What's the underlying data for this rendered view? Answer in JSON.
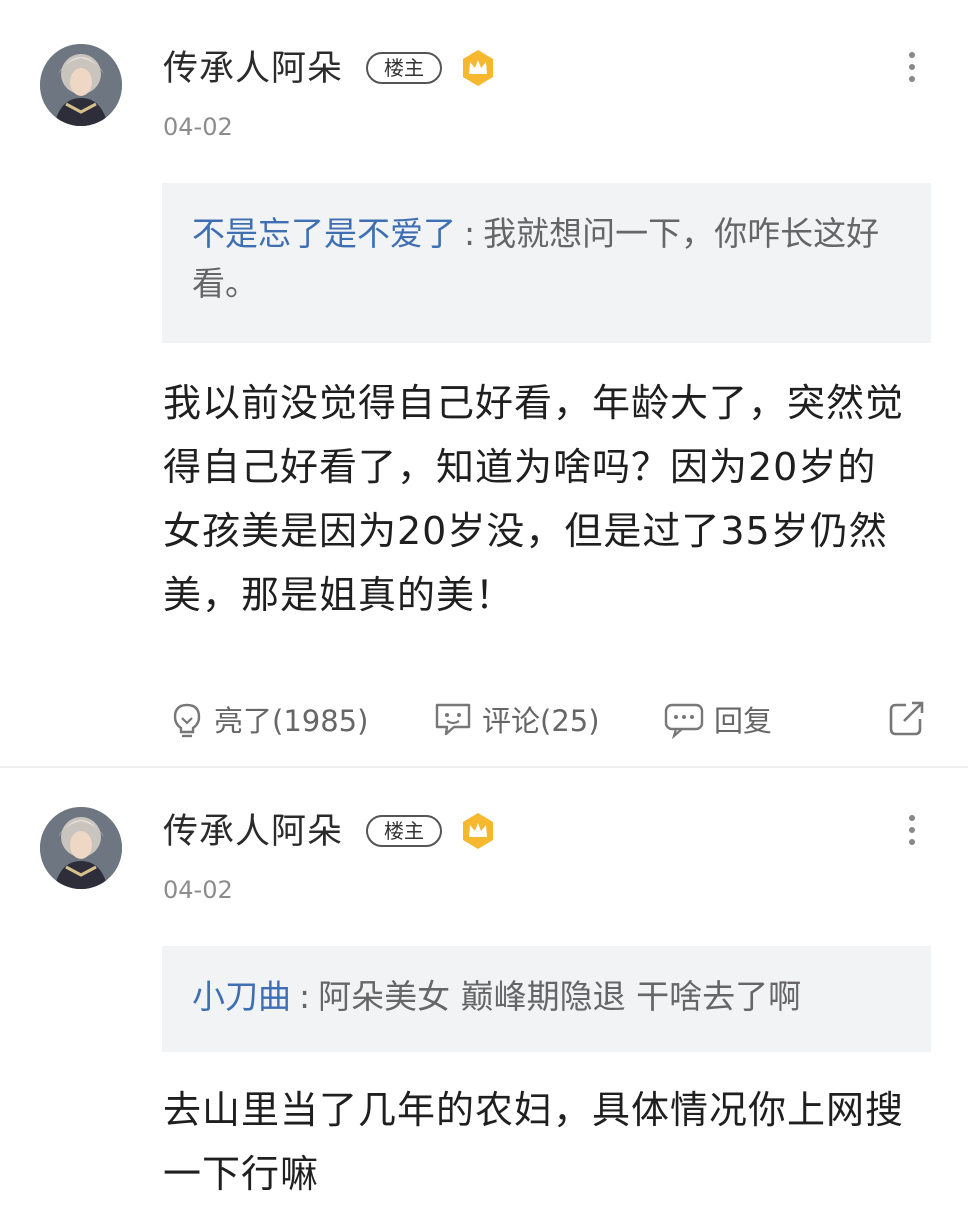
{
  "posts": [
    {
      "author": "传承人阿朵",
      "badge": "楼主",
      "date": "04-02",
      "quote_user": "不是忘了是不爱了",
      "quote_sep": ":",
      "quote_text": "我就想问一下，你咋长这好看。",
      "content": "我以前没觉得自己好看，年龄大了，突然觉得自己好看了，知道为啥吗？因为20岁的女孩美是因为20岁没，但是过了35岁仍然美，那是姐真的美！",
      "actions": {
        "like": "亮了(1985)",
        "comment": "评论(25)",
        "reply": "回复"
      }
    },
    {
      "author": "传承人阿朵",
      "badge": "楼主",
      "date": "04-02",
      "quote_user": "小刀曲",
      "quote_sep": ":",
      "quote_text": "阿朵美女 巅峰期隐退 干啥去了啊",
      "content": "去山里当了几年的农妇，具体情况你上网搜一下行嘛"
    }
  ],
  "colors": {
    "quote_user": "#3e6fb3",
    "crown": "#f5b82e",
    "quote_bg": "#f2f3f5"
  }
}
